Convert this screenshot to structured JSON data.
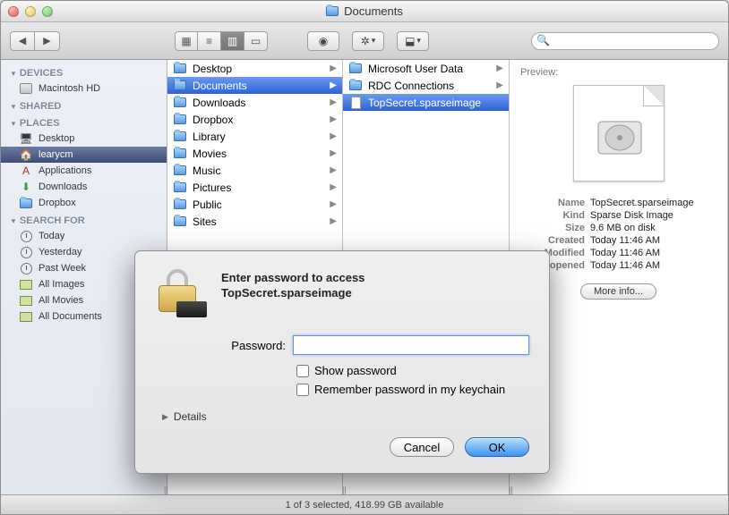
{
  "window": {
    "title": "Documents"
  },
  "toolbar": {
    "search_placeholder": ""
  },
  "sidebar": {
    "sections": [
      {
        "title": "DEVICES",
        "items": [
          {
            "label": "Macintosh HD",
            "icon": "hd"
          }
        ]
      },
      {
        "title": "SHARED",
        "items": []
      },
      {
        "title": "PLACES",
        "items": [
          {
            "label": "Desktop",
            "icon": "desktop"
          },
          {
            "label": "learycm",
            "icon": "home",
            "selected": true
          },
          {
            "label": "Applications",
            "icon": "apps"
          },
          {
            "label": "Downloads",
            "icon": "downloads"
          },
          {
            "label": "Dropbox",
            "icon": "folder"
          }
        ]
      },
      {
        "title": "SEARCH FOR",
        "items": [
          {
            "label": "Today",
            "icon": "clock"
          },
          {
            "label": "Yesterday",
            "icon": "clock"
          },
          {
            "label": "Past Week",
            "icon": "clock"
          },
          {
            "label": "All Images",
            "icon": "img"
          },
          {
            "label": "All Movies",
            "icon": "img"
          },
          {
            "label": "All Documents",
            "icon": "img"
          }
        ]
      }
    ]
  },
  "columns": {
    "col1": [
      {
        "label": "Desktop",
        "arrow": true
      },
      {
        "label": "Documents",
        "arrow": true,
        "selected": true
      },
      {
        "label": "Downloads",
        "arrow": true
      },
      {
        "label": "Dropbox",
        "arrow": true
      },
      {
        "label": "Library",
        "arrow": true
      },
      {
        "label": "Movies",
        "arrow": true
      },
      {
        "label": "Music",
        "arrow": true
      },
      {
        "label": "Pictures",
        "arrow": true
      },
      {
        "label": "Public",
        "arrow": true
      },
      {
        "label": "Sites",
        "arrow": true
      }
    ],
    "col2": [
      {
        "label": "Microsoft User Data",
        "icon": "folder",
        "arrow": true
      },
      {
        "label": "RDC Connections",
        "icon": "folder",
        "arrow": true
      },
      {
        "label": "TopSecret.sparseimage",
        "icon": "file",
        "selected": true
      }
    ]
  },
  "preview": {
    "header": "Preview:",
    "meta": {
      "Name": "TopSecret.sparseimage",
      "Kind": "Sparse Disk Image",
      "Size": "9.6 MB on disk",
      "Created": "Today 11:46 AM",
      "Modified": "Today 11:46 AM",
      "Last opened": "Today 11:46 AM"
    },
    "more_info": "More info..."
  },
  "status": "1 of 3 selected, 418.99 GB available",
  "dialog": {
    "message_line1": "Enter password to access",
    "message_line2": "TopSecret.sparseimage",
    "password_label": "Password:",
    "show_password": "Show password",
    "remember": "Remember password in my keychain",
    "details": "Details",
    "cancel": "Cancel",
    "ok": "OK"
  }
}
